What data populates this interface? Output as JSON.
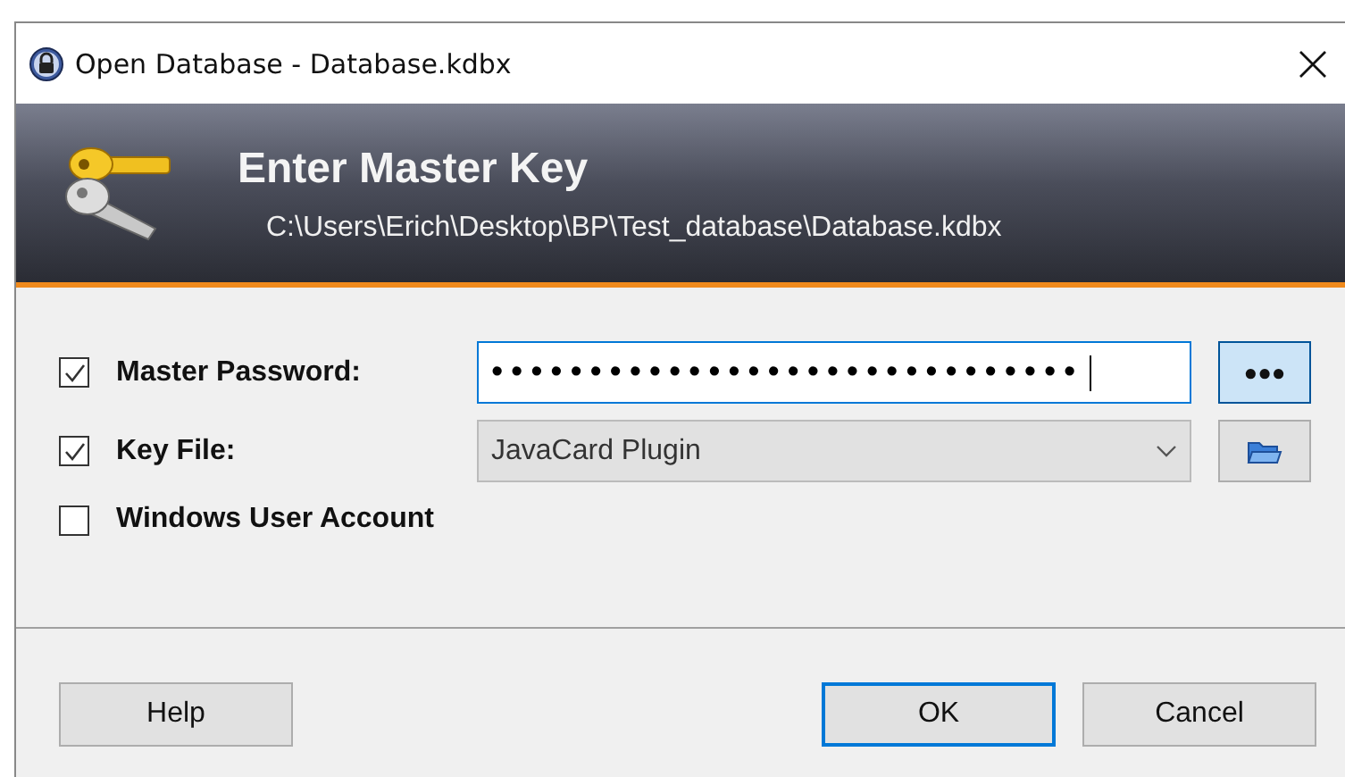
{
  "window": {
    "title": "Open Database - Database.kdbx"
  },
  "banner": {
    "title": "Enter Master Key",
    "path": "C:\\Users\\Erich\\Desktop\\BP\\Test_database\\Database.kdbx"
  },
  "options": [
    {
      "kind": "password",
      "label": "Master Password:",
      "checked": true,
      "value": "••••••••••••••••••••••••••••••",
      "button": {
        "label": "●●●",
        "selected": true
      }
    },
    {
      "kind": "dropdown",
      "label": "Key File:",
      "checked": true,
      "value": "JavaCard Plugin"
    },
    {
      "kind": "checkbox",
      "label": "Windows User Account",
      "checked": false
    }
  ],
  "buttons": [
    {
      "label": "Help",
      "default": false
    },
    {
      "label": "OK",
      "default": true
    },
    {
      "label": "Cancel",
      "default": false
    }
  ]
}
